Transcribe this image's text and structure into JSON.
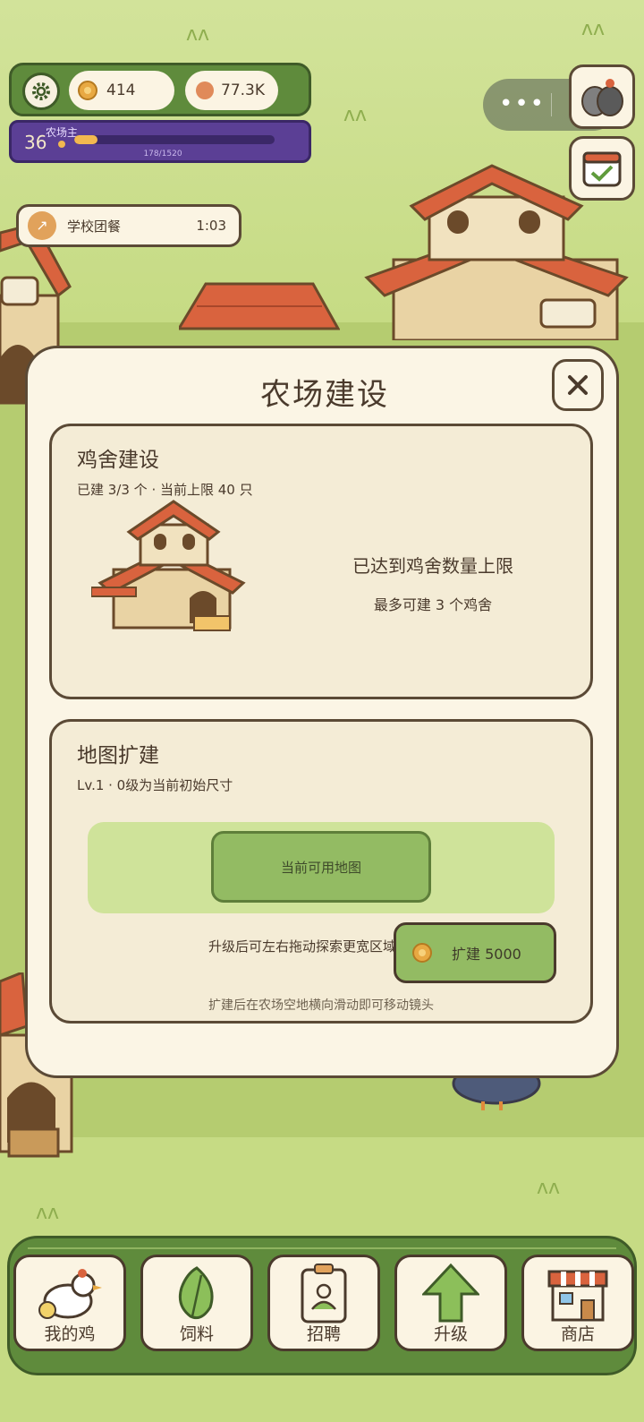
{
  "hud": {
    "coins": "414",
    "gems": "77.3K",
    "level": "36",
    "level_title": "农场主",
    "xp_text": "178/1520",
    "xp_progress": 0.117
  },
  "task": {
    "label": "学校团餐",
    "time": "1:03"
  },
  "modal": {
    "title": "农场建设",
    "coop": {
      "title": "鸡舍建设",
      "subtitle": "已建 3/3 个 · 当前上限 40 只",
      "max_message": "已达到鸡舍数量上限",
      "max_detail": "最多可建 3 个鸡舍"
    },
    "map": {
      "title": "地图扩建",
      "subtitle": "Lv.1 · 0级为当前初始尺寸",
      "current_map_label": "当前可用地图",
      "hint": "升级后可左右拖动探索更宽区域",
      "expand_label": "扩建 5000",
      "footer_hint": "扩建后在农场空地横向滑动即可移动镜头"
    }
  },
  "nav": {
    "items": [
      {
        "label": "我的鸡",
        "icon": "chicken-icon"
      },
      {
        "label": "饲料",
        "icon": "leaf-icon"
      },
      {
        "label": "招聘",
        "icon": "badge-icon"
      },
      {
        "label": "升级",
        "icon": "arrow-up-icon"
      },
      {
        "label": "商店",
        "icon": "shop-icon"
      }
    ]
  },
  "colors": {
    "hud_green": "#5f8b3c",
    "level_purple": "#5b3f95",
    "card_bg": "#f4ecd6",
    "button_green": "#93bb63",
    "roof_red": "#d9633e"
  }
}
